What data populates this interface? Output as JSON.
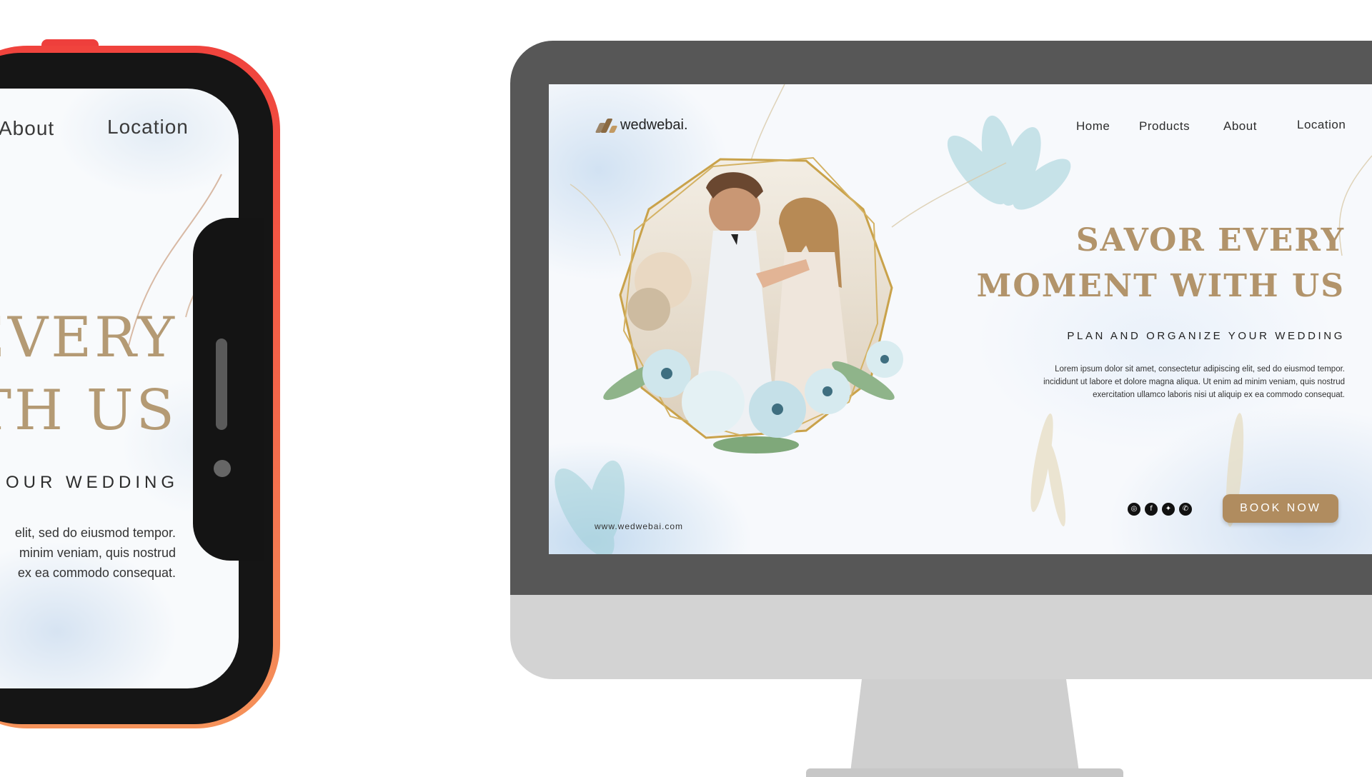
{
  "phone": {
    "nav": {
      "about": "About",
      "location": "Location"
    },
    "headline": [
      "EVERY",
      "TH US"
    ],
    "subtitle": "OUR WEDDING",
    "paragraph": [
      "elit, sed do eiusmod tempor.",
      "minim veniam, quis nostrud",
      "ex ea commodo consequat."
    ]
  },
  "desktop": {
    "logo": {
      "text": "wedwebai.",
      "icon": "logo-mark-icon"
    },
    "nav": {
      "home": "Home",
      "products": "Products",
      "about": "About",
      "location": "Location"
    },
    "headline": [
      "SAVOR EVERY",
      "MOMENT WITH US"
    ],
    "subtitle": "PLAN AND ORGANIZE YOUR WEDDING",
    "paragraph": [
      "Lorem ipsum dolor sit amet, consectetur adipiscing elit, sed do eiusmod tempor.",
      "incididunt ut labore et dolore magna aliqua. Ut enim ad minim veniam, quis nostrud",
      "exercitation ullamco laboris nisi ut aliquip ex ea commodo consequat."
    ],
    "url": "www.wedwebai.com",
    "social": [
      "instagram-icon",
      "facebook-icon",
      "twitter-icon",
      "whatsapp-icon"
    ],
    "cta": "BOOK NOW"
  },
  "colors": {
    "accent_gold": "#b2946b",
    "button_gold": "#b08c5f",
    "phone_frame": "#f0433d",
    "monitor_bezel": "#575757",
    "monitor_chin": "#d3d3d3"
  }
}
